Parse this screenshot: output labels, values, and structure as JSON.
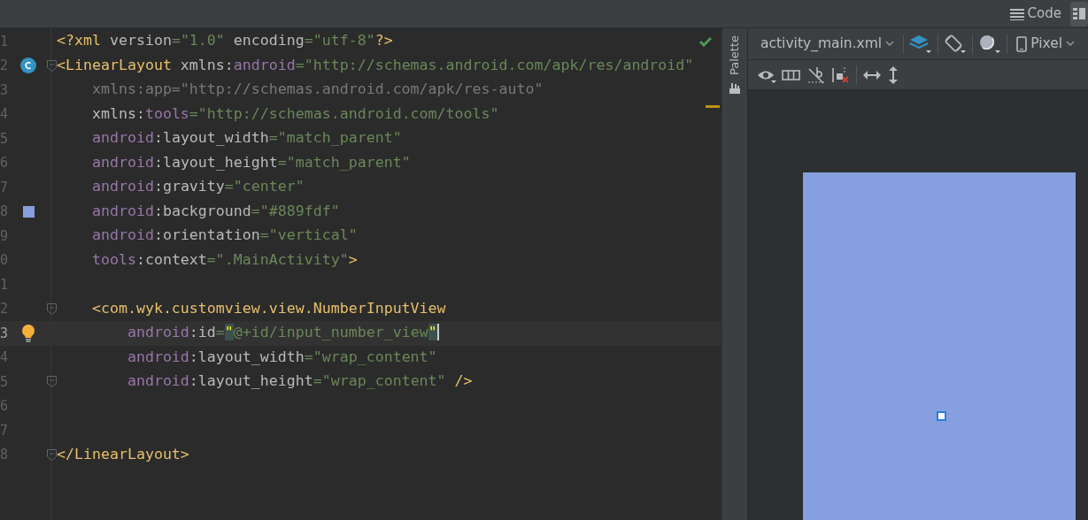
{
  "view_modes": [
    {
      "label": "Code",
      "selected": false
    },
    {
      "selected": true
    }
  ],
  "editor": {
    "lines": [
      {
        "number": "1",
        "kind": "plain",
        "fold": false,
        "current": false,
        "tokens": [
          {
            "kind": "tag",
            "text": "<?xml"
          },
          {
            "kind": "attr",
            "text": " version"
          },
          {
            "kind": "str",
            "text": "=\"1.0\""
          },
          {
            "kind": "attr",
            "text": " encoding"
          },
          {
            "kind": "str",
            "text": "=\"utf-8\""
          },
          {
            "kind": "tag",
            "text": "?>"
          }
        ]
      },
      {
        "number": "2",
        "kind": "class",
        "fold": true,
        "current": false,
        "tokens": [
          {
            "kind": "tag",
            "text": "<LinearLayout"
          },
          {
            "kind": "attr",
            "text": " xmlns:"
          },
          {
            "kind": "ns",
            "text": "android"
          },
          {
            "kind": "str",
            "text": "=\"http://schemas.android.com/apk/res/android\""
          }
        ]
      },
      {
        "number": "3",
        "kind": "plain",
        "fold": false,
        "current": false,
        "tokens": [
          {
            "kind": "unused",
            "text": "    xmlns:app=\"http://schemas.android.com/apk/res-auto\""
          }
        ]
      },
      {
        "number": "4",
        "kind": "plain",
        "fold": false,
        "current": false,
        "tokens": [
          {
            "kind": "attr",
            "text": "    xmlns:"
          },
          {
            "kind": "ns",
            "text": "tools"
          },
          {
            "kind": "str",
            "text": "=\"http://schemas.android.com/tools\""
          }
        ]
      },
      {
        "number": "5",
        "kind": "plain",
        "fold": false,
        "current": false,
        "tokens": [
          {
            "kind": "ns",
            "text": "    android"
          },
          {
            "kind": "attr",
            "text": ":layout_width"
          },
          {
            "kind": "str",
            "text": "=\"match_parent\""
          }
        ]
      },
      {
        "number": "6",
        "kind": "plain",
        "fold": false,
        "current": false,
        "tokens": [
          {
            "kind": "ns",
            "text": "    android"
          },
          {
            "kind": "attr",
            "text": ":layout_height"
          },
          {
            "kind": "str",
            "text": "=\"match_parent\""
          }
        ]
      },
      {
        "number": "7",
        "kind": "plain",
        "fold": false,
        "current": false,
        "tokens": [
          {
            "kind": "ns",
            "text": "    android"
          },
          {
            "kind": "attr",
            "text": ":gravity"
          },
          {
            "kind": "str",
            "text": "=\"center\""
          }
        ]
      },
      {
        "number": "8",
        "kind": "swatch",
        "fold": false,
        "current": false,
        "tokens": [
          {
            "kind": "ns",
            "text": "    android"
          },
          {
            "kind": "attr",
            "text": ":background"
          },
          {
            "kind": "str",
            "text": "=\"#889fdf\""
          }
        ]
      },
      {
        "number": "9",
        "kind": "plain",
        "fold": false,
        "current": false,
        "tokens": [
          {
            "kind": "ns",
            "text": "    android"
          },
          {
            "kind": "attr",
            "text": ":orientation"
          },
          {
            "kind": "str",
            "text": "=\"vertical\""
          }
        ]
      },
      {
        "number": "0",
        "kind": "plain",
        "fold": false,
        "current": false,
        "tokens": [
          {
            "kind": "ns",
            "text": "    tools"
          },
          {
            "kind": "attr",
            "text": ":context"
          },
          {
            "kind": "str",
            "text": "=\".MainActivity\""
          },
          {
            "kind": "tag",
            "text": ">"
          }
        ]
      },
      {
        "number": "1",
        "kind": "plain",
        "fold": false,
        "current": false
      },
      {
        "number": "2",
        "kind": "plain",
        "fold": true,
        "current": false,
        "tokens": [
          {
            "kind": "tag",
            "text": "    <com.wyk.customview.view.NumberInputView"
          }
        ]
      },
      {
        "number": "3",
        "kind": "bulb",
        "fold": false,
        "current": true,
        "tokens": [
          {
            "kind": "ns",
            "text": "        android"
          },
          {
            "kind": "attr",
            "text": ":id"
          },
          {
            "kind": "str",
            "text": "="
          },
          {
            "kind": "match",
            "text": "\""
          },
          {
            "kind": "str",
            "text": "@+id/input_number_view"
          },
          {
            "kind": "match",
            "text": "\""
          }
        ]
      },
      {
        "number": "4",
        "kind": "plain",
        "fold": false,
        "current": false,
        "tokens": [
          {
            "kind": "ns",
            "text": "        android"
          },
          {
            "kind": "attr",
            "text": ":layout_width"
          },
          {
            "kind": "str",
            "text": "=\"wrap_content\""
          }
        ]
      },
      {
        "number": "5",
        "kind": "plain",
        "fold": true,
        "current": false,
        "tokens": [
          {
            "kind": "ns",
            "text": "        android"
          },
          {
            "kind": "attr",
            "text": ":layout_height"
          },
          {
            "kind": "str",
            "text": "=\"wrap_content\""
          },
          {
            "kind": "tag",
            "text": " />"
          }
        ]
      },
      {
        "number": "6",
        "kind": "plain",
        "fold": false,
        "current": false
      },
      {
        "number": "7",
        "kind": "plain",
        "fold": false,
        "current": false
      },
      {
        "number": "8",
        "kind": "plain",
        "fold": true,
        "current": false,
        "tokens": [
          {
            "kind": "tag",
            "text": "</LinearLayout>"
          }
        ]
      }
    ]
  },
  "palette_label": "Palette",
  "design": {
    "file": "activity_main.xml",
    "device": "Pixel"
  }
}
